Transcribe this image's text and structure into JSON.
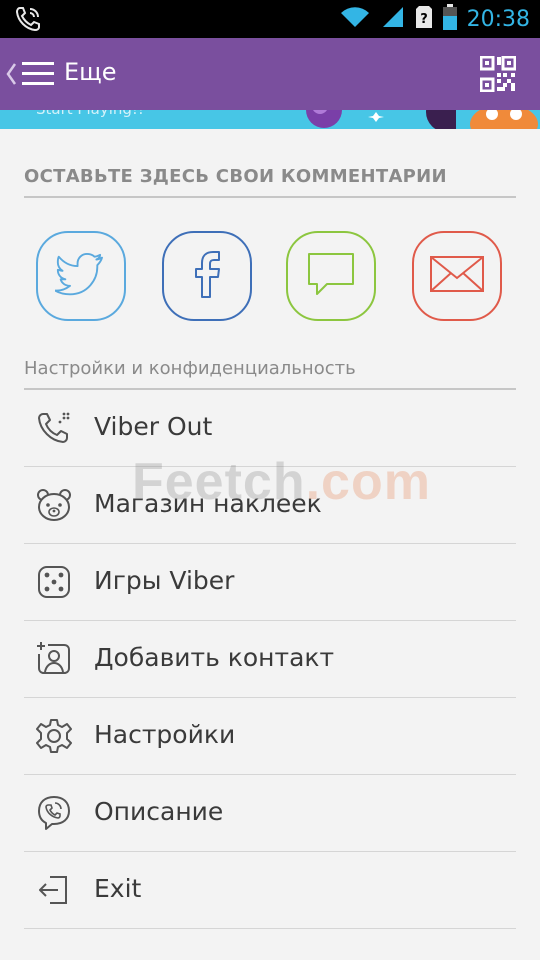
{
  "status_bar": {
    "time": "20:38",
    "icons": [
      "phone-call-icon",
      "wifi-icon",
      "signal-icon",
      "unknown-sim-icon",
      "battery-icon"
    ]
  },
  "app_bar": {
    "title": "Еще",
    "icons": [
      "back-icon",
      "menu-icon",
      "qr-code-icon"
    ],
    "color": "#7a4f9e"
  },
  "banner": {
    "text": "Start Playing!!",
    "color": "#47c6e6"
  },
  "feedback": {
    "title": "ОСТАВЬТЕ ЗДЕСЬ СВОИ КОММЕНТАРИИ",
    "buttons": [
      {
        "icon": "twitter-icon",
        "color": "#5aa9de"
      },
      {
        "icon": "facebook-icon",
        "color": "#3e6fb8"
      },
      {
        "icon": "chat-bubble-icon",
        "color": "#8cc63f"
      },
      {
        "icon": "mail-icon",
        "color": "#e05a4a"
      }
    ]
  },
  "settings_section": {
    "title": "Настройки и конфиденциальность",
    "items": [
      {
        "label": "Viber Out",
        "icon": "phone-out-icon"
      },
      {
        "label": "Магазин наклеек",
        "icon": "bear-icon"
      },
      {
        "label": "Игры Viber",
        "icon": "dice-icon"
      },
      {
        "label": "Добавить контакт",
        "icon": "add-contact-icon"
      },
      {
        "label": "Настройки",
        "icon": "gear-icon"
      },
      {
        "label": "Описание",
        "icon": "viber-icon"
      },
      {
        "label": "Exit",
        "icon": "exit-icon"
      }
    ]
  },
  "watermark": {
    "part1": "Feetch",
    "part2": ".com"
  }
}
